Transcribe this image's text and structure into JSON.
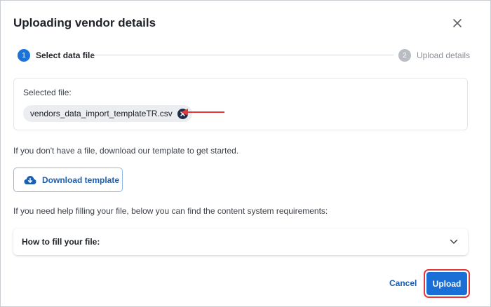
{
  "dialog": {
    "title": "Uploading vendor details"
  },
  "stepper": {
    "steps": [
      {
        "number": "1",
        "label": "Select data file",
        "state": "active"
      },
      {
        "number": "2",
        "label": "Upload details",
        "state": "inactive"
      }
    ]
  },
  "file_card": {
    "label": "Selected file:",
    "file_name": "vendors_data_import_templateTR.csv"
  },
  "template_section": {
    "info": "If you don't have a file, download our template to get started.",
    "download_label": "Download template"
  },
  "help_section": {
    "info": "If you need help filling your file, below you can find the content system requirements:",
    "accordion_label": "How to fill your file:"
  },
  "footer": {
    "cancel_label": "Cancel",
    "upload_label": "Upload"
  },
  "colors": {
    "accent": "#1a73d9",
    "annotation_red": "#e0393e"
  },
  "icons": {
    "close": "close-icon",
    "chip_remove": "remove-file-icon",
    "download": "cloud-download-icon",
    "accordion": "chevron-down-icon"
  }
}
